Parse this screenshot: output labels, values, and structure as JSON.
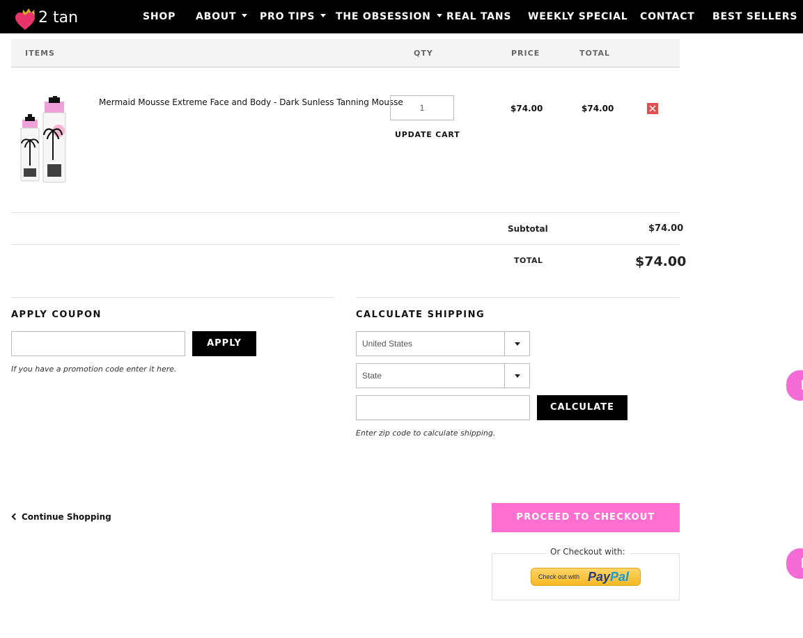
{
  "brand": {
    "logo_text": "2 tan",
    "heart_color": "#e8336b",
    "crown_color": "#d4a62a"
  },
  "nav": {
    "items": [
      {
        "label": "SHOP",
        "has_caret": false
      },
      {
        "label": "ABOUT",
        "has_caret": true
      },
      {
        "label": "PRO TIPS",
        "has_caret": true
      },
      {
        "label": "THE OBSESSION",
        "has_caret": true
      },
      {
        "label": "REAL TANS",
        "has_caret": false
      },
      {
        "label": "WEEKLY SPECIAL",
        "has_caret": false
      },
      {
        "label": "CONTACT",
        "has_caret": false
      },
      {
        "label": "BEST SELLERS",
        "has_caret": false
      }
    ]
  },
  "cart": {
    "headers": {
      "items": "ITEMS",
      "qty": "QTY",
      "price": "PRICE",
      "total": "TOTAL"
    },
    "line_item": {
      "name": "Mermaid Mousse Extreme Face and Body - Dark Sunless Tanning Mousse",
      "qty": "1",
      "update_label": "UPDATE CART",
      "price": "$74.00",
      "total": "$74.00",
      "remove_icon": "close-icon"
    },
    "subtotal_label": "Subtotal",
    "subtotal_value": "$74.00",
    "total_label": "TOTAL",
    "total_value": "$74.00"
  },
  "coupon": {
    "title": "APPLY COUPON",
    "input_placeholder": "",
    "button_label": "APPLY",
    "hint": "If you have a promotion code enter it here."
  },
  "shipping": {
    "title": "CALCULATE SHIPPING",
    "country_selected": "United States",
    "state_selected": "State",
    "zip_placeholder": "",
    "button_label": "CALCULATE",
    "hint": "Enter zip code to calculate shipping."
  },
  "footer": {
    "continue_label": "Continue Shopping",
    "checkout_label": "PROCEED TO CHECKOUT",
    "alt_checkout_label": "Or Checkout with:",
    "paypal_prefix": "Check out with",
    "paypal_word1": "Pay",
    "paypal_word2": "Pal"
  },
  "colors": {
    "checkout": "#ff6fcf",
    "remove": "#e05050",
    "bubble": "#f46bd6"
  }
}
